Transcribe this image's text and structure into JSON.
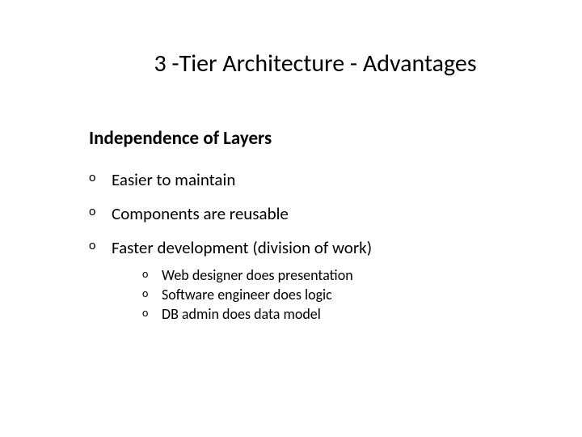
{
  "title": "3 -Tier Architecture - Advantages",
  "subtitle": "Independence of Layers",
  "bullets": [
    {
      "text": "Easier to maintain"
    },
    {
      "text": "Components are reusable"
    },
    {
      "text": "Faster development (division of work)",
      "subbullets": [
        "Web designer does presentation",
        "Software engineer does logic",
        "DB admin does data model"
      ]
    }
  ]
}
